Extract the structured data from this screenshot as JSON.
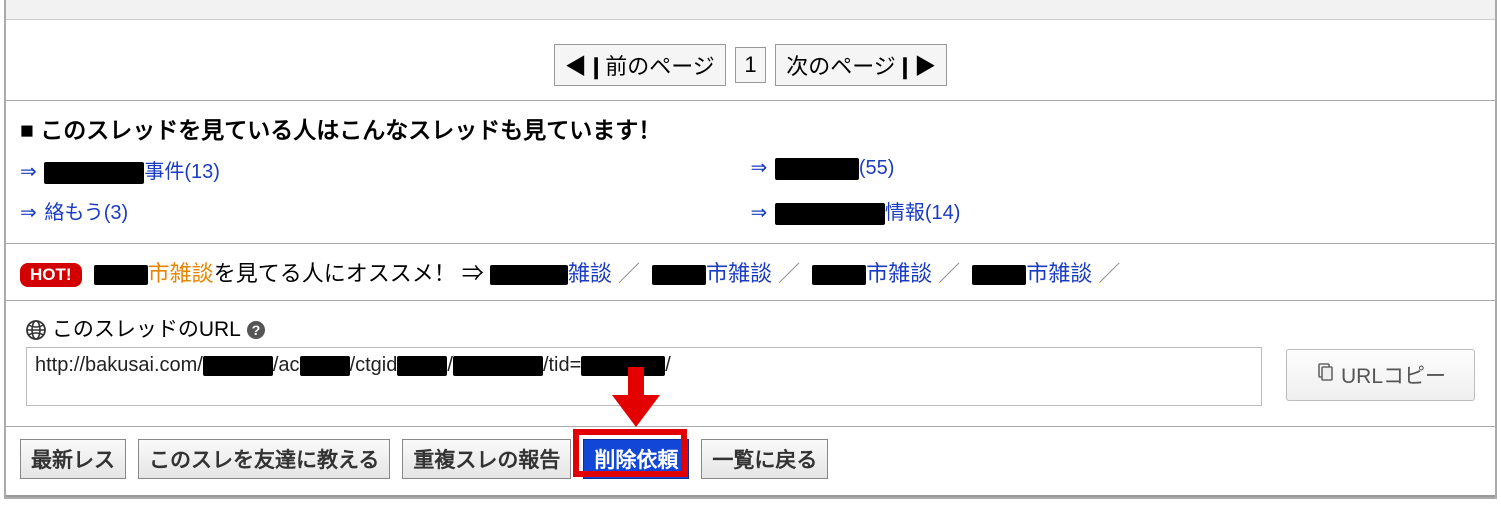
{
  "pager": {
    "prev": "◀❙前のページ",
    "current": "1",
    "next": "次のページ❙▶"
  },
  "heading": "■ このスレッドを見ている人はこんなスレッドも見ています！",
  "related": {
    "arrow": "⇒",
    "items": [
      {
        "suffix": "事件",
        "count": "(13)"
      },
      {
        "suffix": "",
        "count": "(55)"
      },
      {
        "prefix": "絡もう",
        "count": "(3)"
      },
      {
        "suffix": "情報",
        "count": "(14)"
      }
    ]
  },
  "hot": {
    "badge": "HOT!",
    "orange": "市雑談",
    "tail": "を見てる人にオススメ！ ⇒",
    "link1": "雑談",
    "link2": "市雑談",
    "link3": "市雑談",
    "link4": "市雑談"
  },
  "url": {
    "label": "このスレッドのURL",
    "seg1": "http://bakusai.com/",
    "seg2": "/ac",
    "seg3": "/ctgid",
    "seg4": "/",
    "seg5": "/tid=",
    "seg6": "/",
    "copy": "URLコピー"
  },
  "actions": {
    "latest": "最新レス",
    "tell": "このスレを友達に教える",
    "dup": "重複スレの報告",
    "delete": "削除依頼",
    "back": "一覧に戻る"
  }
}
